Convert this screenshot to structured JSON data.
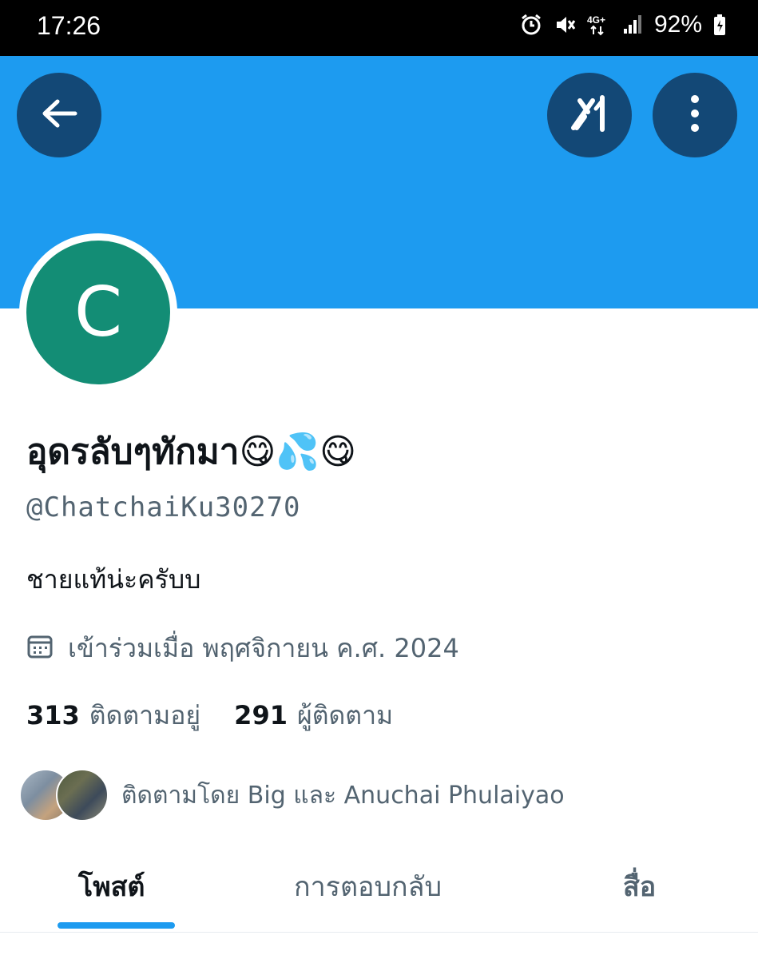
{
  "status_bar": {
    "time": "17:26",
    "battery": "92%",
    "icons": [
      "alarm-icon",
      "mute-icon",
      "4g-icon",
      "signal-icon",
      "battery-icon"
    ]
  },
  "header": {
    "back_icon": "arrow-left-icon",
    "grok_icon": "grok-icon",
    "more_icon": "more-vertical-icon",
    "banner_color": "#1d9bf0"
  },
  "profile": {
    "avatar_letter": "C",
    "avatar_color": "#138d75",
    "display_name": "อุดรลับๆทักมา😋💦😋",
    "handle": "@ChatchaiKu30270",
    "bio": "ชายแท้น่ะครับบ",
    "joined": "เข้าร่วมเมื่อ พฤศจิกายน ค.ศ. 2024",
    "following_count": "313",
    "following_label": "ติดตามอยู่",
    "followers_count": "291",
    "followers_label": "ผู้ติดตาม",
    "followed_by": "ติดตามโดย Big และ Anuchai Phulaiyao"
  },
  "tabs": {
    "posts": "โพสต์",
    "replies": "การตอบกลับ",
    "media": "สื่อ",
    "active": "posts",
    "accent_color": "#1d9bf0"
  }
}
